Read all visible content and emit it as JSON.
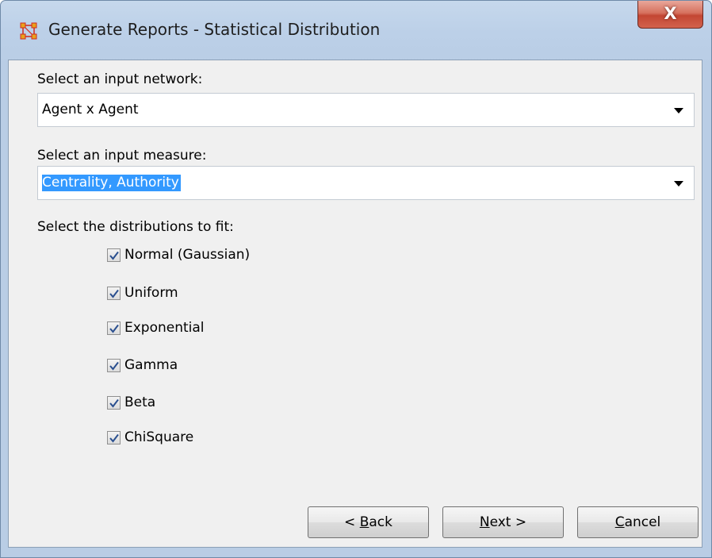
{
  "window": {
    "title": "Generate Reports - Statistical Distribution",
    "close_label": "X"
  },
  "network": {
    "label": "Select an input network:",
    "value": "Agent x Agent"
  },
  "measure": {
    "label": "Select an input measure:",
    "value": "Centrality, Authority"
  },
  "distributions": {
    "label": "Select the distributions to fit:",
    "items": [
      {
        "label": "Normal (Gaussian)",
        "checked": true
      },
      {
        "label": "Uniform",
        "checked": true
      },
      {
        "label": "Exponential",
        "checked": true
      },
      {
        "label": "Gamma",
        "checked": true
      },
      {
        "label": "Beta",
        "checked": true
      },
      {
        "label": "ChiSquare",
        "checked": true
      }
    ]
  },
  "buttons": {
    "back": {
      "prefix": "< ",
      "mnemonic": "B",
      "rest": "ack"
    },
    "next": {
      "prefix": "",
      "mnemonic": "N",
      "rest": "ext >"
    },
    "cancel": {
      "prefix": "",
      "mnemonic": "C",
      "rest": "ancel"
    }
  },
  "colors": {
    "selection": "#3399ff",
    "close_button": "#c34633",
    "icon_orange": "#e8a21c",
    "icon_red": "#d02a1f"
  }
}
